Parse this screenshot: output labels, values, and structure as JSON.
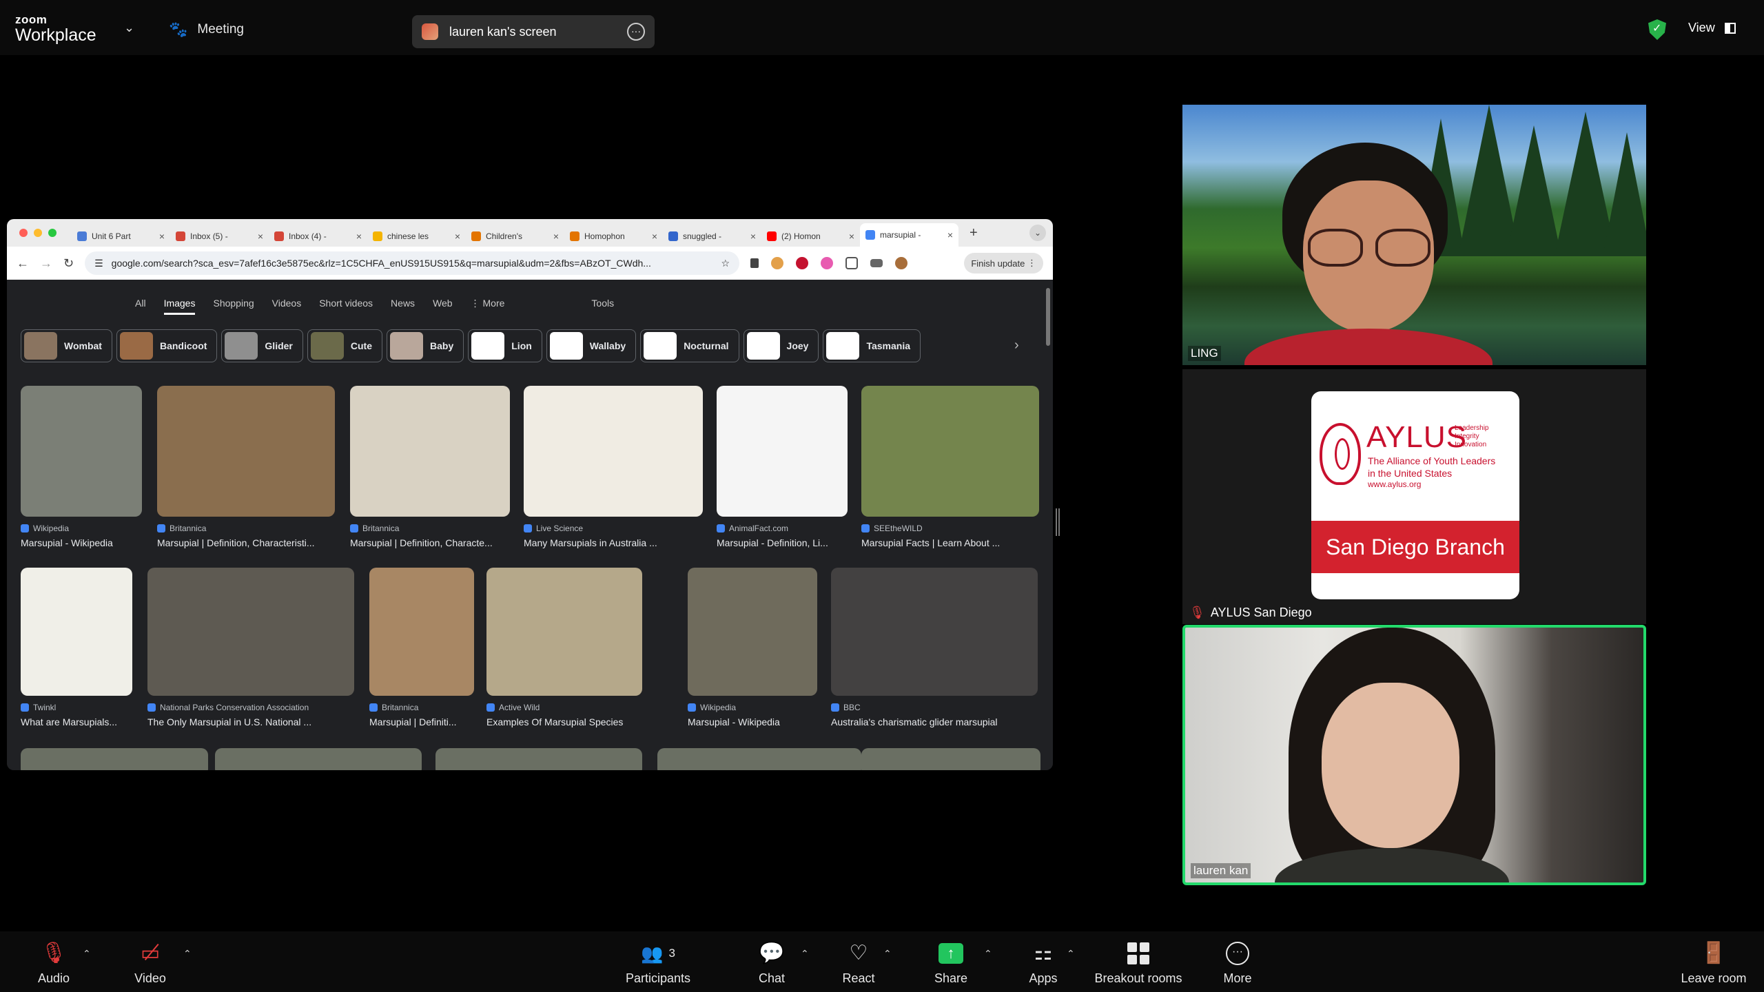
{
  "topbar": {
    "logo_small": "zoom",
    "logo_big": "Workplace",
    "meeting_label": "Meeting",
    "screen_share_label": "lauren kan's screen",
    "view_label": "View"
  },
  "browser": {
    "tabs": [
      {
        "label": "Unit 6 Part",
        "color": "#4a7bd6"
      },
      {
        "label": "Inbox (5) -",
        "color": "#d44638"
      },
      {
        "label": "Inbox (4) -",
        "color": "#d44638"
      },
      {
        "label": "chinese les",
        "color": "#f4b400"
      },
      {
        "label": "Children's",
        "color": "#e37400"
      },
      {
        "label": "Homophon",
        "color": "#e37400"
      },
      {
        "label": "snuggled -",
        "color": "#3366cc"
      },
      {
        "label": "(2) Homon",
        "color": "#ff0000"
      },
      {
        "label": "marsupial -",
        "color": "#4285f4"
      }
    ],
    "url": "google.com/search?sca_esv=7afef16c3e5875ec&rlz=1C5CHFA_enUS915US915&q=marsupial&udm=2&fbs=ABzOT_CWdh...",
    "finish_update": "Finish update"
  },
  "google": {
    "tabs": [
      "All",
      "Images",
      "Shopping",
      "Videos",
      "Short videos",
      "News",
      "Web",
      "⋮ More"
    ],
    "tools": "Tools",
    "chips": [
      {
        "label": "Wombat",
        "color": "#8a7460"
      },
      {
        "label": "Bandicoot",
        "color": "#9a6a45"
      },
      {
        "label": "Glider",
        "color": "#8f8f8f"
      },
      {
        "label": "Cute",
        "color": "#6b6a4a"
      },
      {
        "label": "Baby",
        "color": "#b9a79b"
      },
      {
        "label": "Lion",
        "color": "#ffffff"
      },
      {
        "label": "Wallaby",
        "color": "#ffffff"
      },
      {
        "label": "Nocturnal",
        "color": "#ffffff"
      },
      {
        "label": "Joey",
        "color": "#ffffff"
      },
      {
        "label": "Tasmania",
        "color": "#ffffff"
      }
    ],
    "row1": [
      {
        "source": "Wikipedia",
        "title": "Marsupial - Wikipedia"
      },
      {
        "source": "Britannica",
        "title": "Marsupial | Definition, Characteristi..."
      },
      {
        "source": "Britannica",
        "title": "Marsupial | Definition, Characte..."
      },
      {
        "source": "Live Science",
        "title": "Many Marsupials in Australia ..."
      },
      {
        "source": "AnimalFact.com",
        "title": "Marsupial - Definition, Li..."
      },
      {
        "source": "SEEtheWILD",
        "title": "Marsupial Facts | Learn About ..."
      }
    ],
    "row2": [
      {
        "source": "Twinkl",
        "title": "What are Marsupials..."
      },
      {
        "source": "National Parks Conservation Association",
        "title": "The Only Marsupial in U.S. National ..."
      },
      {
        "source": "Britannica",
        "title": "Marsupial | Definiti..."
      },
      {
        "source": "Active Wild",
        "title": "Examples Of Marsupial Species"
      },
      {
        "source": "Wikipedia",
        "title": "Marsupial - Wikipedia"
      },
      {
        "source": "BBC",
        "title": "Australia's charismatic glider marsupial"
      }
    ]
  },
  "participants_panel": {
    "tile1_name": "LING",
    "tile2_name": "AYLUS San Diego",
    "tile3_name": "lauren kan",
    "aylus": {
      "word": "AYLUS",
      "tag1": "Leadership",
      "tag2": "Integrity",
      "tag3": "Innovation",
      "line1": "The Alliance of Youth Leaders",
      "line2": "in the United States",
      "web": "www.aylus.org",
      "branch": "San Diego Branch"
    }
  },
  "toolbar": {
    "audio": "Audio",
    "video": "Video",
    "participants": "Participants",
    "participants_count": "3",
    "chat": "Chat",
    "react": "React",
    "share": "Share",
    "apps": "Apps",
    "breakout": "Breakout rooms",
    "more": "More",
    "leave": "Leave room"
  }
}
